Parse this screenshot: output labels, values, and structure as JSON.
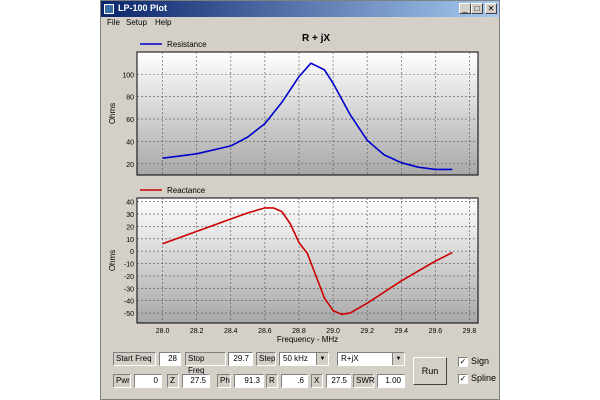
{
  "window": {
    "title": "LP-100 Plot",
    "min_glyph": "_",
    "max_glyph": "□",
    "close_glyph": "✕"
  },
  "menu": [
    "File",
    "Setup",
    "Help"
  ],
  "chart_title": "R + jX",
  "chart_data": [
    {
      "type": "line",
      "xlim": [
        27.85,
        29.85
      ],
      "ylim": [
        10,
        120
      ],
      "yticks": [
        20,
        40,
        60,
        80,
        100
      ],
      "ylabel": "Ohms",
      "grid": true,
      "legend_position": "top-left",
      "series": [
        {
          "name": "Resistance",
          "color": "#0000cc",
          "x": [
            28.0,
            28.2,
            28.4,
            28.5,
            28.6,
            28.7,
            28.8,
            28.87,
            28.95,
            29.0,
            29.1,
            29.2,
            29.3,
            29.4,
            29.5,
            29.6,
            29.7
          ],
          "y": [
            25,
            29,
            36,
            44,
            56,
            75,
            98,
            110,
            104,
            92,
            64,
            41,
            28,
            21,
            17,
            15,
            15
          ]
        }
      ]
    },
    {
      "type": "line",
      "xlim": [
        27.85,
        29.85
      ],
      "ylim": [
        -58,
        43
      ],
      "yticks": [
        40,
        30,
        20,
        10,
        0,
        -10,
        -20,
        -30,
        -40,
        -50
      ],
      "ylabel": "Ohms",
      "xlabel": "Frequency - MHz",
      "xticks": [
        28.0,
        28.2,
        28.4,
        28.6,
        28.8,
        29.0,
        29.2,
        29.4,
        29.6,
        29.8
      ],
      "grid": true,
      "legend_position": "top-left",
      "series": [
        {
          "name": "Reactance",
          "color": "#cc0000",
          "x": [
            28.0,
            28.2,
            28.4,
            28.5,
            28.6,
            28.65,
            28.7,
            28.75,
            28.8,
            28.85,
            28.9,
            28.95,
            29.0,
            29.05,
            29.1,
            29.2,
            29.3,
            29.4,
            29.5,
            29.6,
            29.7
          ],
          "y": [
            6,
            16,
            26,
            31,
            35,
            35,
            32,
            22,
            7,
            -2,
            -20,
            -38,
            -48,
            -51,
            -50,
            -42,
            -33,
            -24,
            -16,
            -8,
            -1
          ]
        }
      ]
    }
  ],
  "controls": {
    "start_freq_label": "Start Freq",
    "start_freq_value": "28",
    "stop_freq_label": "Stop Freq",
    "stop_freq_value": "29.7",
    "step_label": "Step",
    "step_value": "50 kHz",
    "mode_value": "R+jX",
    "pwr_label": "Pwr",
    "pwr_value": "0",
    "z_label": "Z",
    "z_value": "27.5",
    "ph_label": "Ph",
    "ph_value": "91.3",
    "r_label": "R",
    "r_value": ".6",
    "x_label": "X",
    "x_value": "27.5",
    "swr_label": "SWR",
    "swr_value": "1.00",
    "run_label": "Run",
    "sign_label": "Sign",
    "sign_checked": true,
    "spline_label": "Spline",
    "spline_checked": true,
    "check_glyph": "✓",
    "dropdown_glyph": "▼"
  }
}
